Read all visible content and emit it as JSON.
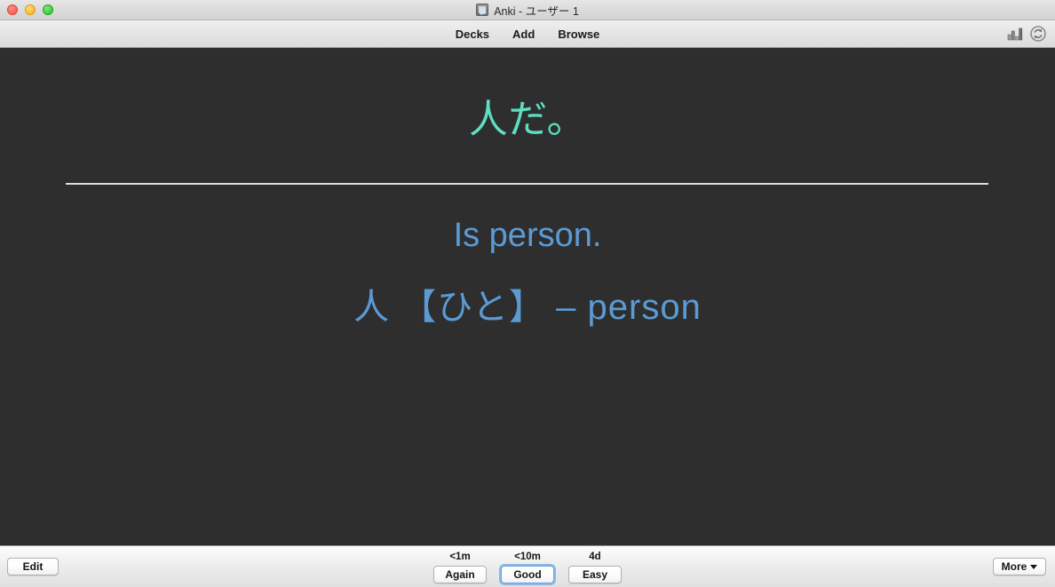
{
  "window": {
    "title": "Anki - ユーザー 1",
    "app_icon": "anki-app-icon",
    "traffic_lights": {
      "close": "close-button",
      "minimize": "minimize-button",
      "maximize": "maximize-button"
    }
  },
  "toolbar": {
    "menu": [
      {
        "label": "Decks",
        "name": "decks"
      },
      {
        "label": "Add",
        "name": "add"
      },
      {
        "label": "Browse",
        "name": "browse"
      }
    ],
    "icons": [
      {
        "name": "stats-icon",
        "title": "Stats"
      },
      {
        "name": "sync-icon",
        "title": "Sync"
      }
    ]
  },
  "card": {
    "question": "人だ。",
    "answer": "Is person.",
    "vocabulary": "人 【ひと】 – person",
    "question_color": "#5fdec0",
    "answer_color": "#5b9bd5",
    "background_color": "#2e2e2e",
    "divider_color": "#dcdcdc"
  },
  "bottom_bar": {
    "edit_label": "Edit",
    "more_label": "More",
    "more_caret": "chevron-down-icon",
    "answer_buttons": [
      {
        "interval": "<1m",
        "label": "Again",
        "focused": false
      },
      {
        "interval": "<10m",
        "label": "Good",
        "focused": true
      },
      {
        "interval": "4d",
        "label": "Easy",
        "focused": false
      }
    ]
  },
  "colors": {
    "focus_ring": "#8cb8e8",
    "traffic_close": "#f5534a",
    "traffic_min": "#f5ad20",
    "traffic_max": "#2bbe2b"
  }
}
